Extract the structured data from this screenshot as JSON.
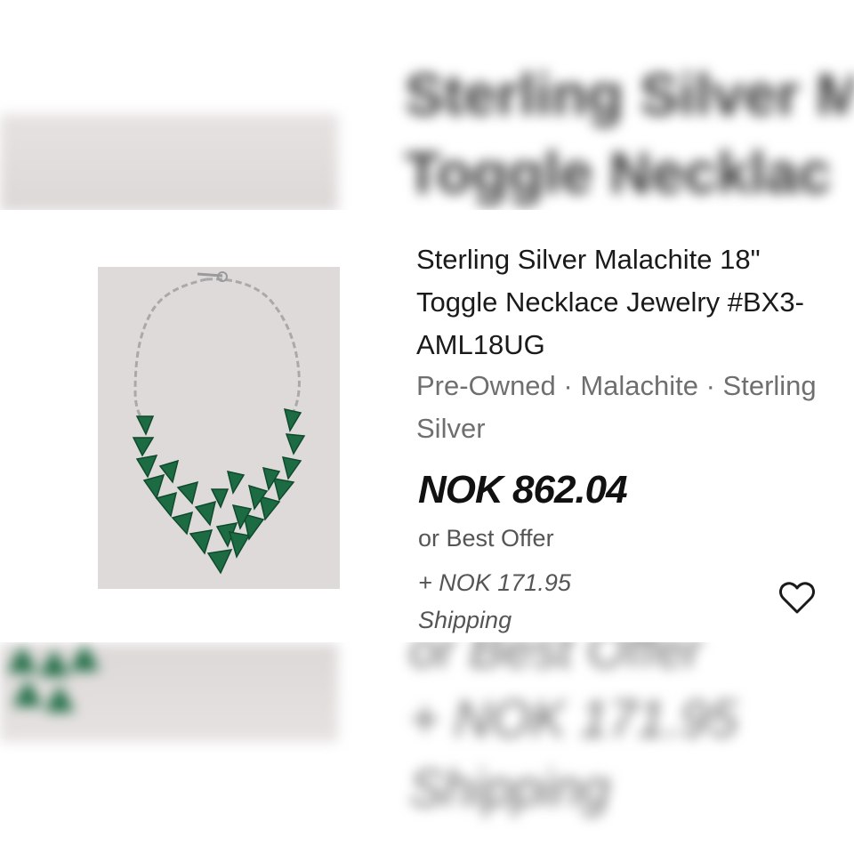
{
  "listing": {
    "title": "Sterling Silver Malachite 18\" Toggle Necklace Jewelry #BX3-AML18UG",
    "aspects": "Pre-Owned · Malachite · Sterling Silver",
    "price": "NOK 862.04",
    "offer_text": "or Best Offer",
    "shipping_line1": "+ NOK 171.95",
    "shipping_line2": "Shipping",
    "photo_alt": "Malachite necklace photo",
    "watch_icon": "heart-icon"
  },
  "backdrop": {
    "title_line1": "Sterling Silver M",
    "title_line2": "Toggle Necklac",
    "offer_line1": "or Best Offer",
    "shipping_line1": "+ NOK 171.95",
    "shipping_line2": "Shipping"
  },
  "colors": {
    "gem": "#1d6b43",
    "gem_dark": "#0f4a2c",
    "chain": "#a9a9a9",
    "photo_bg": "#dedad9"
  }
}
